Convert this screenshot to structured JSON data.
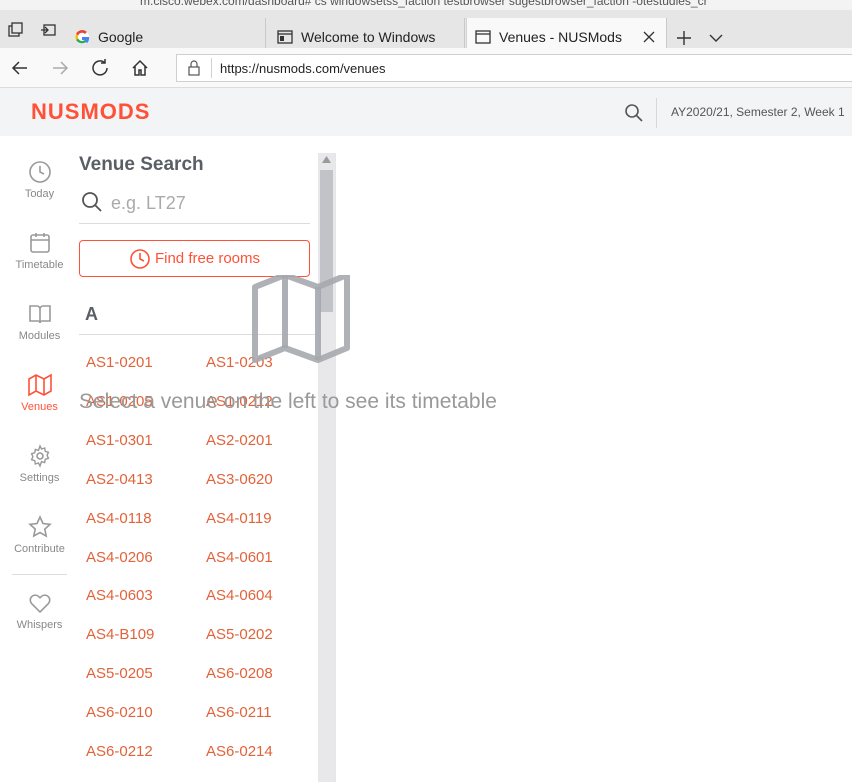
{
  "browser": {
    "top_url_fragment": "m.cisco.webex.com/dashboard#  cs  windowsetss_faction  testbrowser  sugestbrowser_faction  -otestudies_cr",
    "tabs": [
      {
        "label": "Google",
        "icon": "google-icon"
      },
      {
        "label": "Welcome to Windows",
        "icon": "window-icon"
      },
      {
        "label": "Venues - NUSMods",
        "icon": "window-icon",
        "active": true
      }
    ],
    "address": "https://nusmods.com/venues"
  },
  "header": {
    "logo": "NUSMODS",
    "semester": "AY2020/21, Semester 2, Week 1"
  },
  "sidenav": [
    {
      "label": "Today",
      "icon": "clock-icon"
    },
    {
      "label": "Timetable",
      "icon": "calendar-icon"
    },
    {
      "label": "Modules",
      "icon": "book-icon"
    },
    {
      "label": "Venues",
      "icon": "map-icon",
      "active": true
    },
    {
      "label": "Settings",
      "icon": "gear-icon"
    },
    {
      "label": "Contribute",
      "icon": "star-icon"
    },
    {
      "label": "Whispers",
      "icon": "heart-icon"
    }
  ],
  "venue_search": {
    "title": "Venue Search",
    "placeholder": "e.g. LT27",
    "find_free_rooms": "Find free rooms",
    "group_letter": "A",
    "venues": [
      "AS1-0201",
      "AS1-0203",
      "AS1-0205",
      "AS1-0212",
      "AS1-0301",
      "AS2-0201",
      "AS2-0413",
      "AS3-0620",
      "AS4-0118",
      "AS4-0119",
      "AS4-0206",
      "AS4-0601",
      "AS4-0603",
      "AS4-0604",
      "AS4-B109",
      "AS5-0202",
      "AS5-0205",
      "AS6-0208",
      "AS6-0210",
      "AS6-0211",
      "AS6-0212",
      "AS6-0214"
    ]
  },
  "main": {
    "placeholder_text": "Select a venue on the left to see its timetable"
  },
  "colors": {
    "accent": "#ff5138",
    "venue_link": "#e0633b",
    "muted": "#888888"
  }
}
